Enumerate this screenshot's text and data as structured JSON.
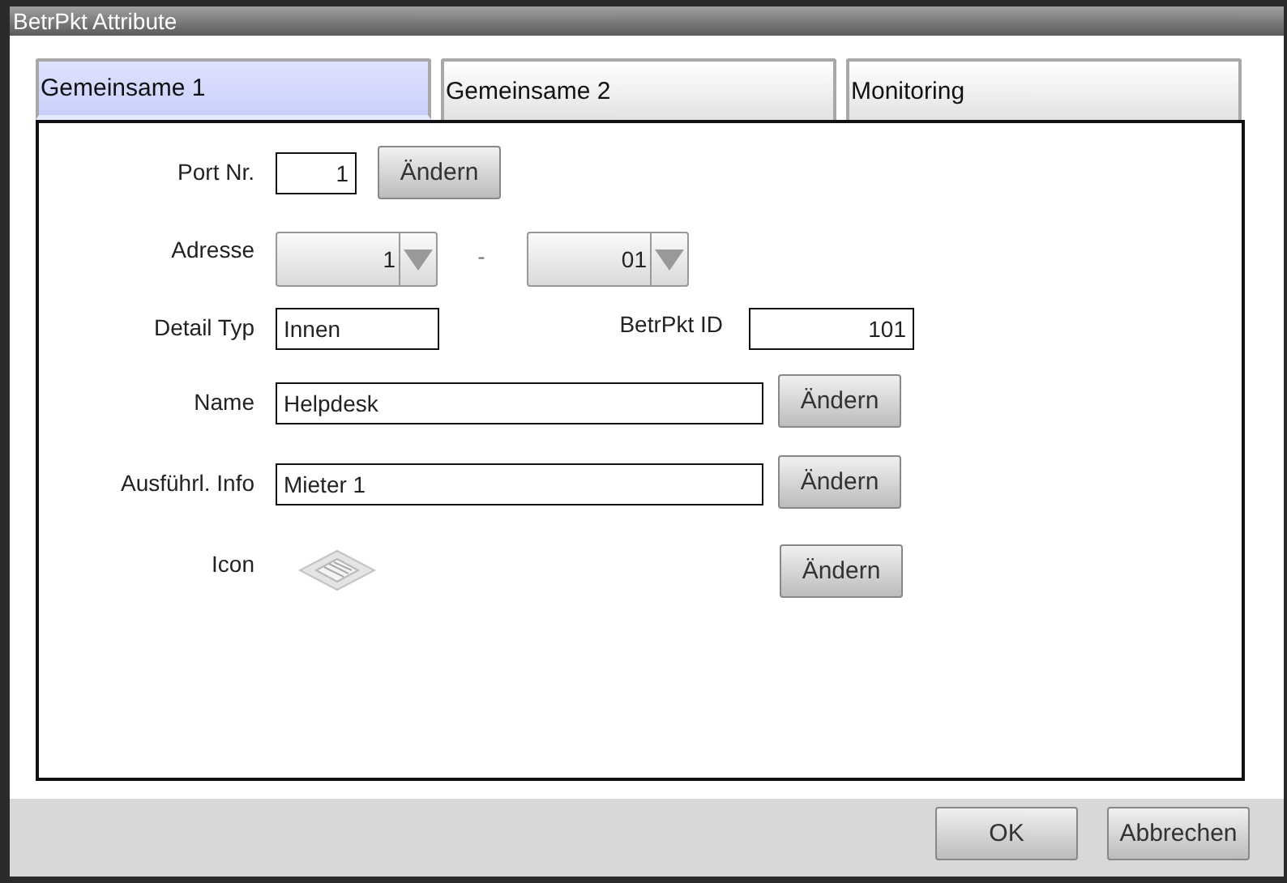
{
  "window": {
    "title": "BetrPkt Attribute"
  },
  "tabs": [
    {
      "label": "Gemeinsame 1",
      "selected": true
    },
    {
      "label": "Gemeinsame 2",
      "selected": false
    },
    {
      "label": "Monitoring",
      "selected": false
    }
  ],
  "rows": [
    {
      "kind": "short",
      "label": "Port Nr.",
      "value": "1",
      "button": "Ändern"
    },
    {
      "kind": "dropdowns",
      "label": "Adresse",
      "dropdowns": [
        "1",
        "01"
      ],
      "separator": "-"
    },
    {
      "kind": "pair",
      "label": "Detail Typ",
      "value": "Innen",
      "label_2": "BetrPkt ID",
      "value_2": "101"
    },
    {
      "kind": "wide",
      "label": "Name",
      "value": "Helpdesk",
      "button": "Ändern"
    },
    {
      "kind": "wide",
      "label": "Ausführl. Info",
      "value": "Mieter 1",
      "button": "Ändern"
    },
    {
      "kind": "icon",
      "label": "Icon",
      "button": "Ändern"
    }
  ],
  "buttons": [
    "OK",
    "Abbrechen"
  ]
}
